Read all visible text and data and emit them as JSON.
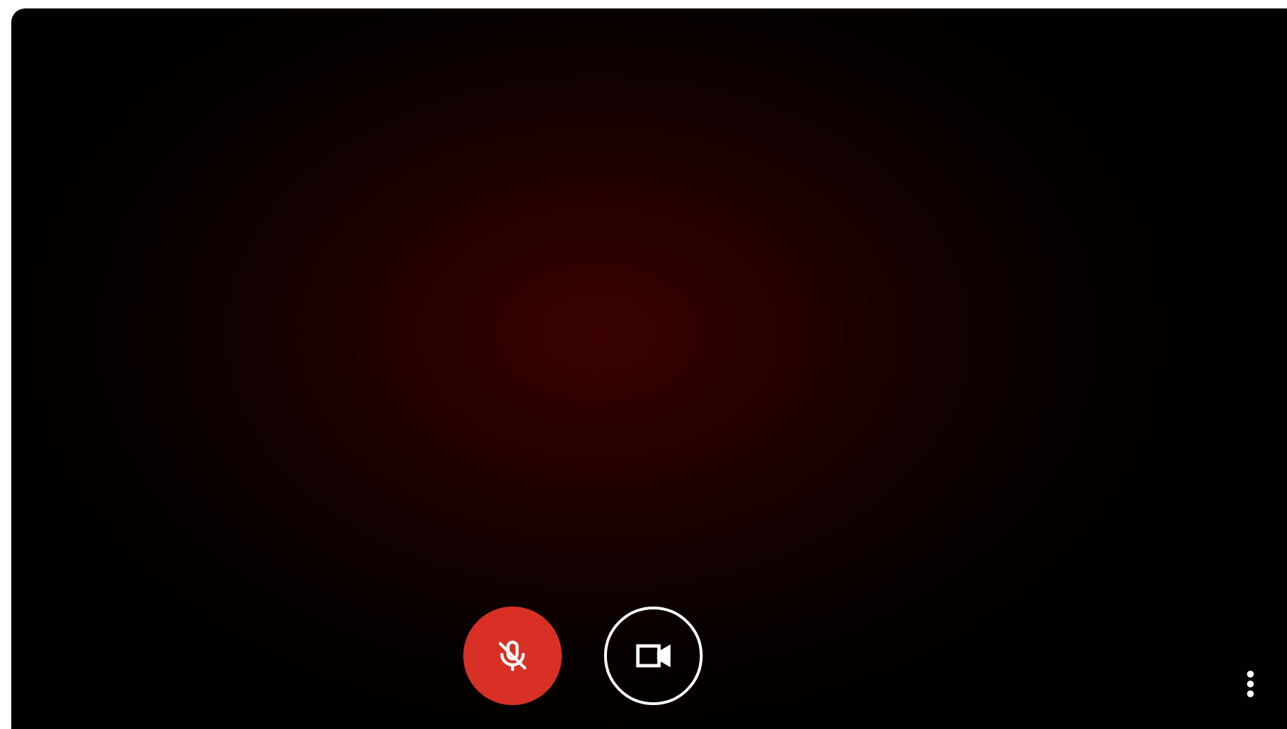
{
  "controls": [
    {
      "kind": "microphone",
      "on": false
    },
    {
      "kind": "camera",
      "on": true
    }
  ]
}
